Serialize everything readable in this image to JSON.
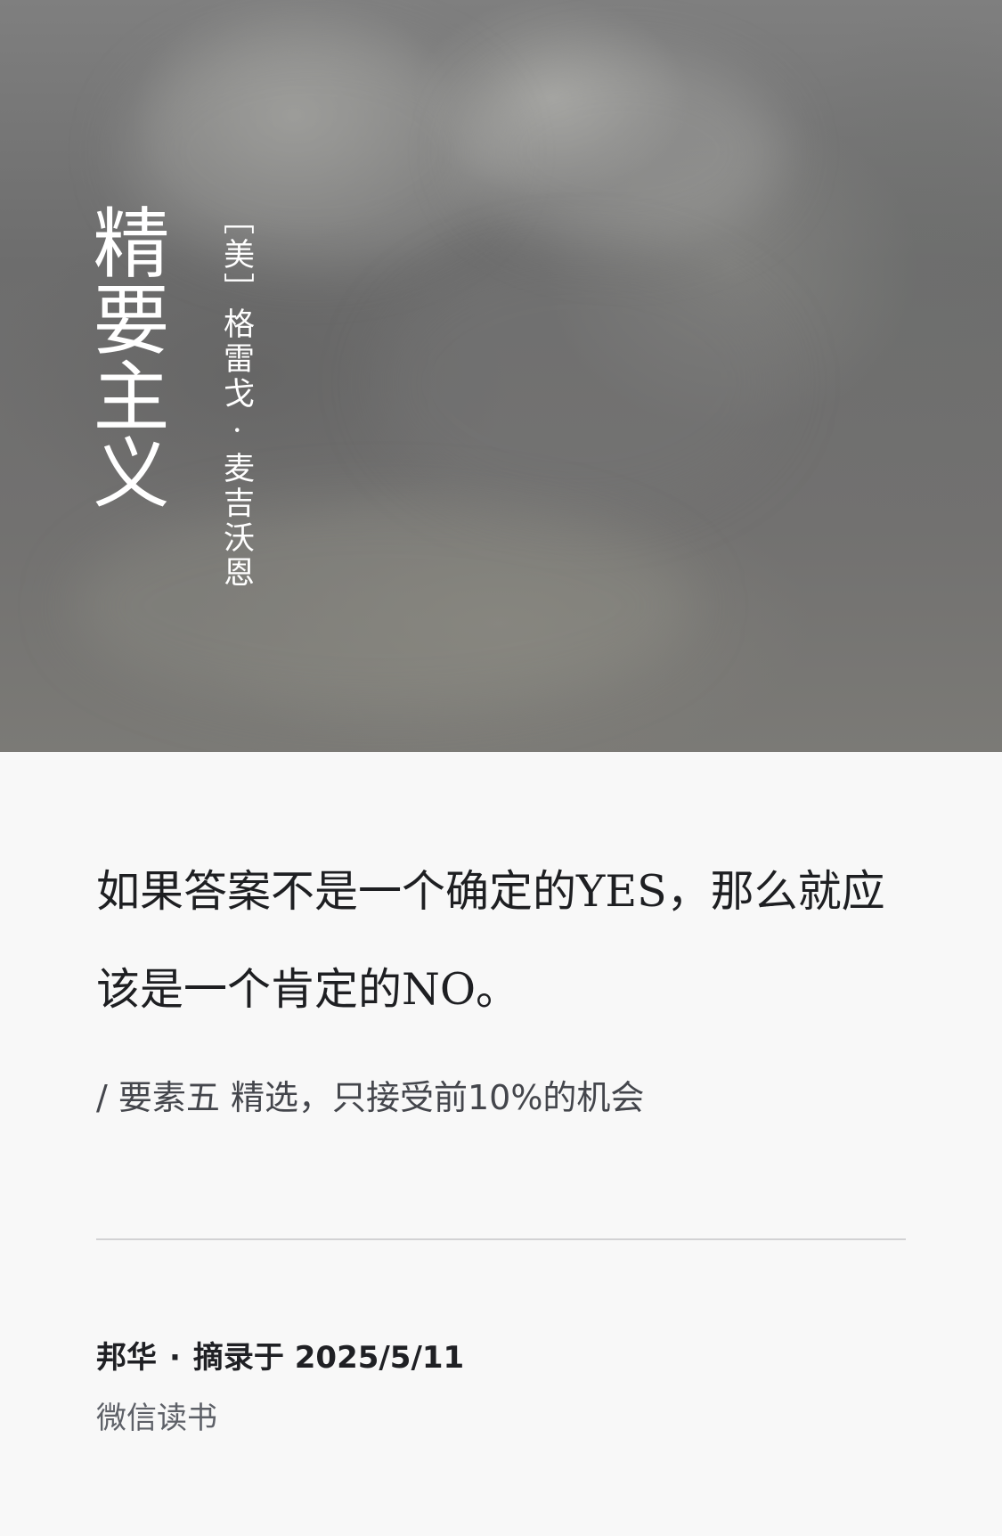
{
  "cover": {
    "title": "精要主义",
    "author": "［美］格雷戈 · 麦吉沃恩"
  },
  "excerpt": {
    "quote": "如果答案不是一个确定的YES，那么就应该是一个肯定的NO。",
    "chapter": "/ 要素五 精选，只接受前10%的机会"
  },
  "footer": {
    "user": "邦华",
    "separator": "·",
    "date_label": "摘录于 2025/5/11",
    "app_name": "微信读书"
  }
}
